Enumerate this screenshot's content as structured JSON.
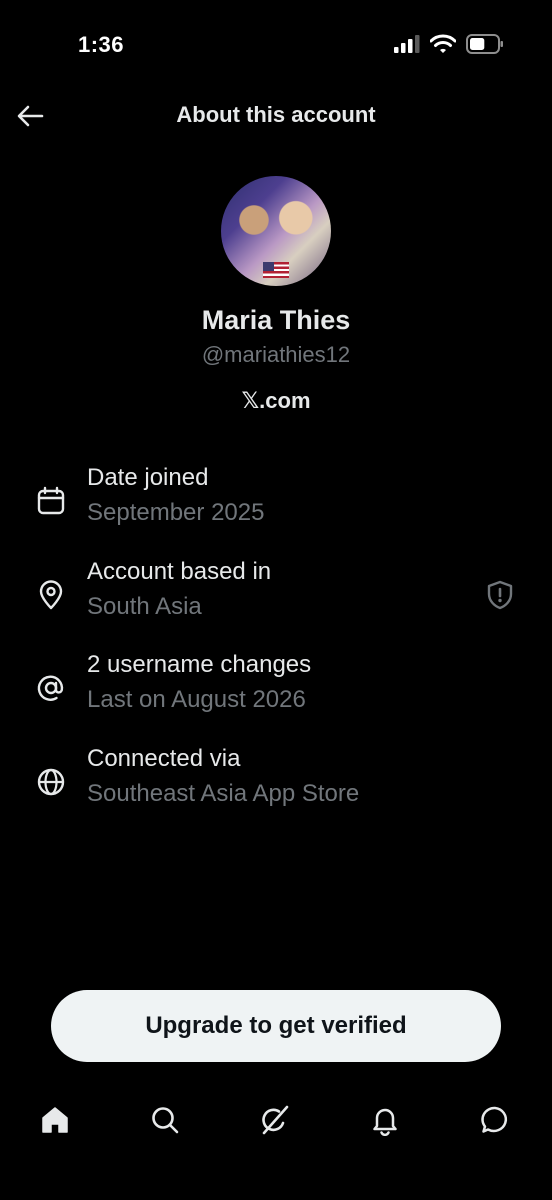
{
  "status_bar": {
    "time": "1:36",
    "battery_level": 0.55
  },
  "header": {
    "title": "About this account",
    "back_icon": "arrow-left-icon"
  },
  "profile": {
    "display_name": "Maria Thies",
    "handle": "@mariathies12",
    "site": "𝕏.com"
  },
  "details": [
    {
      "icon": "calendar-icon",
      "title": "Date joined",
      "value": "September 2025"
    },
    {
      "icon": "location-pin-icon",
      "title": "Account based in",
      "value": "South Asia"
    },
    {
      "icon": "at-sign-icon",
      "title": "2 username changes",
      "value": "Last on August 2026"
    },
    {
      "icon": "globe-icon",
      "title": "Connected via",
      "value": "Southeast Asia App Store"
    }
  ],
  "cta": {
    "label": "Upgrade to get verified"
  },
  "tabs": [
    "home-icon",
    "search-icon",
    "grok-icon",
    "notifications-bell-icon",
    "messages-icon"
  ],
  "colors": {
    "background": "#000000",
    "primary_text": "#e7e9ea",
    "secondary_text": "#71767b",
    "button_bg": "#eff3f4"
  }
}
